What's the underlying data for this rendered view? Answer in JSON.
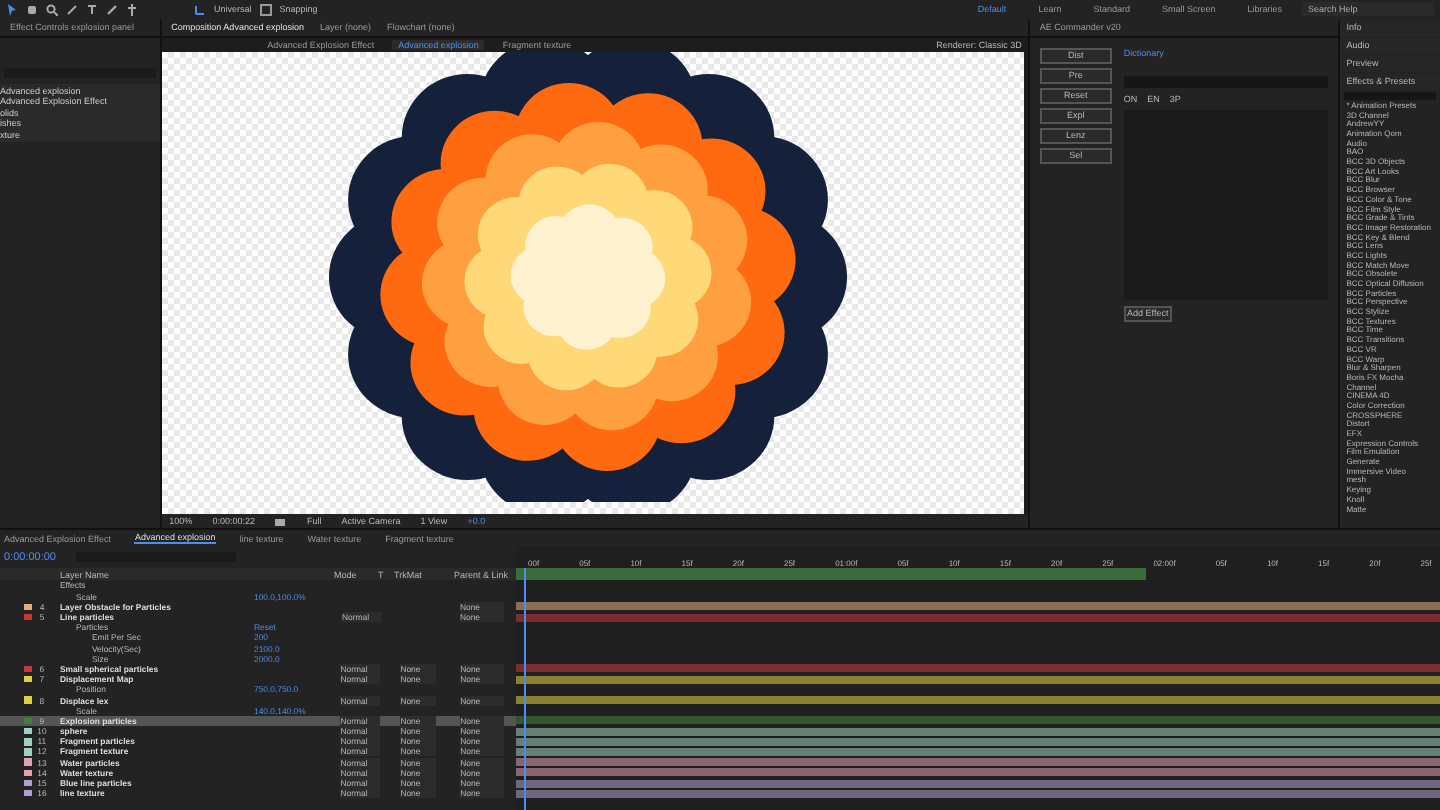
{
  "toolbar": {
    "universal": "Universal",
    "snapping": {
      "label": "Snapping",
      "checked": false
    },
    "workspaces": [
      {
        "label": "Default",
        "selected": true
      },
      {
        "label": "Learn",
        "selected": false
      },
      {
        "label": "Standard",
        "selected": false
      },
      {
        "label": "Small Screen",
        "selected": false
      },
      {
        "label": "Libraries",
        "selected": false
      }
    ],
    "search": {
      "placeholder": "Search Help"
    }
  },
  "project": {
    "tab": "Effect Controls explosion panel",
    "items": [
      "Advanced explosion",
      "Advanced Explosion Effect",
      "olids",
      "ishes",
      "xture"
    ]
  },
  "composition": {
    "tabs": [
      {
        "label": "Composition Advanced explosion",
        "selected": true
      },
      {
        "label": "Layer (none)",
        "selected": false
      },
      {
        "label": "Flowchart (none)",
        "selected": false
      }
    ],
    "subtabs": [
      {
        "label": "Advanced Explosion Effect",
        "selected": false
      },
      {
        "label": "Advanced explosion",
        "selected": true
      },
      {
        "label": "Fragment texture",
        "selected": false
      }
    ],
    "renderer": "Renderer: Classic 3D",
    "bottom": {
      "zoom": "100%",
      "time": "0:00:00:22",
      "resolution": "Full",
      "camera": "Active Camera",
      "views": "1 View",
      "exposure": "+0.0"
    }
  },
  "commander": {
    "title": "AE Commander v20",
    "buttons": [
      "Dist",
      "Pre",
      "Reset",
      "Expl",
      "Lenz",
      "Sel"
    ],
    "link": "Dictionary",
    "columns": [
      "ON",
      "EN",
      "3P"
    ],
    "add": "Add Effect"
  },
  "effects": {
    "panels": [
      "Info",
      "Audio",
      "Preview"
    ],
    "title": "Effects & Presets",
    "items": [
      "* Animation Presets",
      "3D Channel",
      "AndrewYY",
      "Animation Qom",
      "Audio",
      "BAO",
      "BCC 3D Objects",
      "BCC Art Looks",
      "BCC Blur",
      "BCC Browser",
      "BCC Color & Tone",
      "BCC Film Style",
      "BCC Grade & Tints",
      "BCC Image Restoration",
      "BCC Key & Blend",
      "BCC Lens",
      "BCC Lights",
      "BCC Match Move",
      "BCC Obsolete",
      "BCC Optical Diffusion",
      "BCC Particles",
      "BCC Perspective",
      "BCC Stylize",
      "BCC Textures",
      "BCC Time",
      "BCC Transitions",
      "BCC VR",
      "BCC Warp",
      "Blur & Sharpen",
      "Boris FX Mocha",
      "Channel",
      "CINEMA 4D",
      "Color Correction",
      "CROSSPHERE",
      "Distort",
      "EFX",
      "Expression Controls",
      "Film Emulation",
      "Generate",
      "Immersive Video",
      "mesh",
      "Keying",
      "Knoll",
      "Matte"
    ]
  },
  "timeline": {
    "tabs": [
      {
        "label": "Advanced Explosion Effect",
        "selected": false
      },
      {
        "label": "Advanced explosion",
        "selected": true
      },
      {
        "label": "line texture",
        "selected": false
      },
      {
        "label": "Water texture",
        "selected": false
      },
      {
        "label": "Fragment texture",
        "selected": false
      }
    ],
    "time": "0:00:00:00",
    "ruler": [
      "00f",
      "05f",
      "10f",
      "15f",
      "20f",
      "25f",
      "01:00f",
      "05f",
      "10f",
      "15f",
      "20f",
      "25f",
      "02:00f",
      "05f",
      "10f",
      "15f",
      "20f",
      "25f"
    ],
    "headers": {
      "name": "Layer Name",
      "mode": "Mode",
      "t": "T",
      "trkmat": "TrkMat",
      "parent": "Parent & Link"
    },
    "rows": [
      {
        "kind": "property",
        "name": "Effects",
        "children": [
          {
            "kind": "property",
            "name": "Scale",
            "value": "100.0,100.0%"
          }
        ]
      },
      {
        "kind": "layer",
        "number": "4",
        "name": "Layer Obstacle for Particles",
        "color": "#e0b080",
        "parent": "None",
        "selected": false
      },
      {
        "kind": "layer",
        "number": "5",
        "name": "Line particles",
        "color": "#c83838",
        "mode": "Normal",
        "parent": "None",
        "selected": false,
        "children": [
          {
            "kind": "property",
            "name": "Particles",
            "value": "Reset",
            "children": [
              {
                "kind": "property",
                "name": "Emit Per Sec",
                "value": "200"
              },
              {
                "kind": "property",
                "name": "Velocity(Sec)",
                "value": "2100.0"
              },
              {
                "kind": "property",
                "name": "Size",
                "value": "2000.0"
              }
            ]
          }
        ]
      },
      {
        "kind": "layer",
        "number": "6",
        "name": "Small spherical particles",
        "color": "#c83838",
        "mode": "Normal",
        "trkmat": "None",
        "parent": "None",
        "selected": false
      },
      {
        "kind": "layer",
        "number": "7",
        "name": "Displacement Map",
        "color": "#e0d040",
        "mode": "Normal",
        "trkmat": "None",
        "parent": "None",
        "selected": false,
        "children": [
          {
            "kind": "property",
            "name": "Position",
            "value": "750.0,750.0"
          }
        ]
      },
      {
        "kind": "layer",
        "number": "8",
        "name": "Displace lex",
        "color": "#e0d040",
        "mode": "Normal",
        "trkmat": "None",
        "parent": "None",
        "selected": false,
        "children": [
          {
            "kind": "property",
            "name": "Scale",
            "value": "140.0,140.0%"
          }
        ]
      },
      {
        "kind": "layer",
        "number": "9",
        "name": "Explosion particles",
        "color": "#3f7f3f",
        "mode": "Normal",
        "trkmat": "None",
        "parent": "None",
        "selected": true
      },
      {
        "kind": "layer",
        "number": "10",
        "name": "sphere",
        "color": "#a0d0c0",
        "mode": "Normal",
        "trkmat": "None",
        "parent": "None",
        "selected": false
      },
      {
        "kind": "layer",
        "number": "11",
        "name": "Fragment particles",
        "color": "#a0d0c0",
        "mode": "Normal",
        "trkmat": "None",
        "parent": "None",
        "selected": false
      },
      {
        "kind": "layer",
        "number": "12",
        "name": "Fragment texture",
        "color": "#a0d0c0",
        "mode": "Normal",
        "trkmat": "None",
        "parent": "None",
        "selected": false
      },
      {
        "kind": "layer",
        "number": "13",
        "name": "Water particles",
        "color": "#e0a0b0",
        "mode": "Normal",
        "trkmat": "None",
        "parent": "None",
        "selected": false
      },
      {
        "kind": "layer",
        "number": "14",
        "name": "Water texture",
        "color": "#e0a0b0",
        "mode": "Normal",
        "trkmat": "None",
        "parent": "None",
        "selected": false
      },
      {
        "kind": "layer",
        "number": "15",
        "name": "Blue line particles",
        "color": "#b0a0d0",
        "mode": "Normal",
        "trkmat": "None",
        "parent": "None",
        "selected": false
      },
      {
        "kind": "layer",
        "number": "16",
        "name": "line texture",
        "color": "#b0a0d0",
        "mode": "Normal",
        "trkmat": "None",
        "parent": "None",
        "selected": false
      }
    ]
  }
}
